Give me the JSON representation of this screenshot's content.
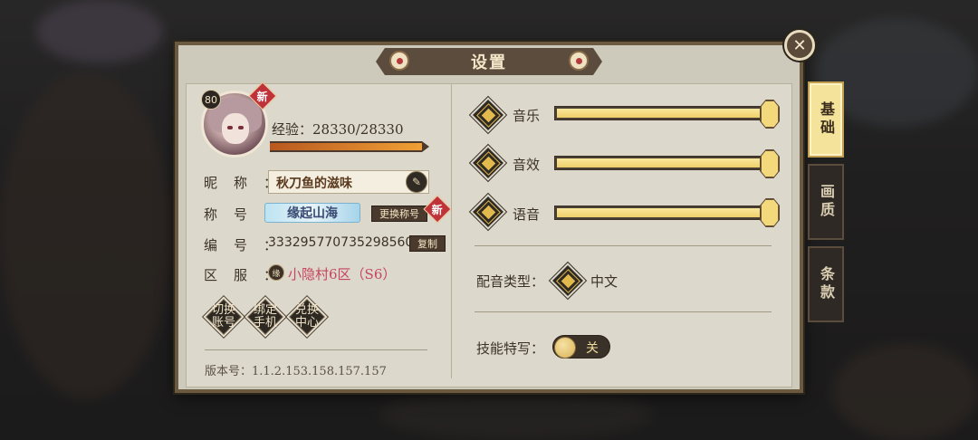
{
  "dialog": {
    "title": "设置",
    "close_glyph": "✕"
  },
  "profile": {
    "level": "80",
    "new_badge": "新",
    "exp_label": "经验：28330/28330",
    "exp_fraction": 1.0,
    "nickname_label": "昵称：",
    "nickname": "秋刀鱼的滋味",
    "title_label": "称号：",
    "title_banner": "缘起山海",
    "change_title_button": "更换称号",
    "id_label": "编号：",
    "id_value": "3332957707352985600",
    "copy_button": "复制",
    "server_label": "区服：",
    "server_icon_text": "缘",
    "server_value": "小隐村6区（S6）"
  },
  "actions": [
    {
      "label": "切换账号"
    },
    {
      "label": "绑定手机"
    },
    {
      "label": "兑换中心"
    }
  ],
  "version_text": "版本号：1.1.2.153.158.157.157",
  "audio": {
    "sliders": [
      {
        "label": "音乐",
        "level": 1.0
      },
      {
        "label": "音效",
        "level": 1.0
      },
      {
        "label": "语音",
        "level": 1.0
      }
    ],
    "voice_type_label": "配音类型：",
    "voice_type_value": "中文",
    "skill_closeup_label": "技能特写：",
    "skill_closeup_state": "关"
  },
  "side_tabs": [
    {
      "label": "基础",
      "active": true
    },
    {
      "label": "画质",
      "active": false
    },
    {
      "label": "条款",
      "active": false
    }
  ],
  "colors": {
    "accent_gold": "#f4e39a",
    "badge_red": "#c0323a",
    "server_pink": "#c7455e"
  }
}
